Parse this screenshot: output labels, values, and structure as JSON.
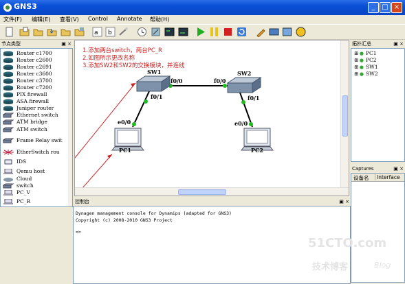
{
  "window": {
    "title": "GNS3",
    "min": "_",
    "max": "□",
    "close": "×"
  },
  "menu": [
    "文件(F)",
    "编辑(E)",
    "查看(V)",
    "Control",
    "Annotate",
    "帮助(H)"
  ],
  "node_panel": {
    "title": "节点类型",
    "items": [
      "Router c1700",
      "Router c2600",
      "Router c2691",
      "Router c3600",
      "Router c3700",
      "Router c7200",
      "PIX firewall",
      "ASA firewall",
      "Juniper router",
      "Ethernet switch",
      "ATM bridge",
      "ATM switch",
      "Frame Relay swit",
      "EtherSwitch rou",
      "IDS",
      "Qemu host",
      "Cloud",
      "switch",
      "PC_V",
      "PC_R"
    ]
  },
  "topology_panel": {
    "title": "拓扑汇总",
    "items": [
      "PC1",
      "PC2",
      "SW1",
      "SW2"
    ]
  },
  "captures_panel": {
    "title": "Captures",
    "col1": "设备名",
    "col2": "Interface"
  },
  "console_panel": {
    "title": "控制台",
    "line1": "Dynagen management console for Dynamips (adapted for GNS3)",
    "line2": "Copyright (c) 2008-2010 GNS3 Project",
    "prompt": "=>"
  },
  "annotation": {
    "line1": "1.添加两台switch，两台PC_R",
    "line2": "2.如图所示更改名称",
    "line3": "3.添加SW2和SW2的交换模块，并连线"
  },
  "canvas": {
    "sw1": "SW1",
    "sw2": "SW2",
    "pc1": "PC1",
    "pc2": "PC2",
    "sw1_e": "f0/0",
    "sw2_w": "f0/0",
    "sw1_s": "f0/1",
    "sw2_s": "f0/1",
    "pc1_port": "e0/0",
    "pc2_port": "e0/0"
  },
  "watermark": {
    "brand": "51CTO.com",
    "sub": "技术博客",
    "blog": "Blog"
  },
  "colors": {
    "titlebar": "#0a4fd6",
    "annotation": "#cc2222",
    "arrow": "#cc2222",
    "led": "#22bb22"
  }
}
